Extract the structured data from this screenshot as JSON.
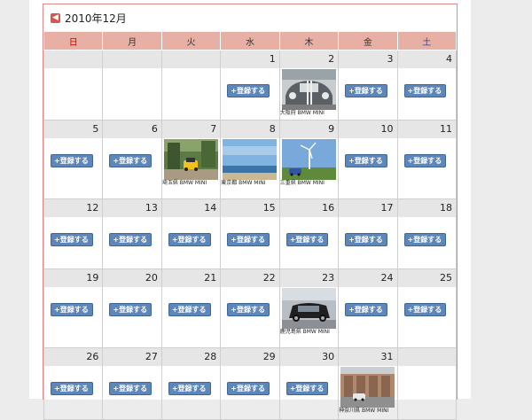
{
  "header": {
    "prev_icon": "arrow-left-icon",
    "title": "2010年12月"
  },
  "weekdays": [
    "日",
    "月",
    "火",
    "水",
    "木",
    "金",
    "土"
  ],
  "register_label": "+登録する",
  "weeks": [
    [
      {
        "day": ""
      },
      {
        "day": ""
      },
      {
        "day": ""
      },
      {
        "day": "1",
        "btn": true
      },
      {
        "day": "2",
        "photo": "car-front",
        "caption": "大阪府 BMW MINI"
      },
      {
        "day": "3",
        "btn": true
      },
      {
        "day": "4",
        "btn": true
      }
    ],
    [
      {
        "day": "5",
        "btn": true
      },
      {
        "day": "6",
        "btn": true
      },
      {
        "day": "7",
        "photo": "yellow-car-garden",
        "caption": "埼玉県 BMW MINI"
      },
      {
        "day": "8",
        "photo": "sea-sky",
        "caption": "東京都 BMW MINI"
      },
      {
        "day": "9",
        "photo": "windmill-car",
        "caption": "三重県 BMW MINI"
      },
      {
        "day": "10",
        "btn": true
      },
      {
        "day": "11",
        "btn": true
      }
    ],
    [
      {
        "day": "12",
        "btn": true
      },
      {
        "day": "13",
        "btn": true
      },
      {
        "day": "14",
        "btn": true
      },
      {
        "day": "15",
        "btn": true
      },
      {
        "day": "16",
        "btn": true
      },
      {
        "day": "17",
        "btn": true
      },
      {
        "day": "18",
        "btn": true
      }
    ],
    [
      {
        "day": "19",
        "btn": true
      },
      {
        "day": "20",
        "btn": true
      },
      {
        "day": "21",
        "btn": true
      },
      {
        "day": "22",
        "btn": true
      },
      {
        "day": "23",
        "photo": "black-mini",
        "caption": "鹿児島県 BMW MINI"
      },
      {
        "day": "24",
        "btn": true
      },
      {
        "day": "25",
        "btn": true
      }
    ],
    [
      {
        "day": "26",
        "btn": true
      },
      {
        "day": "27",
        "btn": true
      },
      {
        "day": "28",
        "btn": true
      },
      {
        "day": "29",
        "btn": true
      },
      {
        "day": "30",
        "btn": true
      },
      {
        "day": "31",
        "photo": "warehouse-car",
        "caption": "神奈川県 BMW MINI"
      },
      {
        "day": ""
      }
    ]
  ]
}
